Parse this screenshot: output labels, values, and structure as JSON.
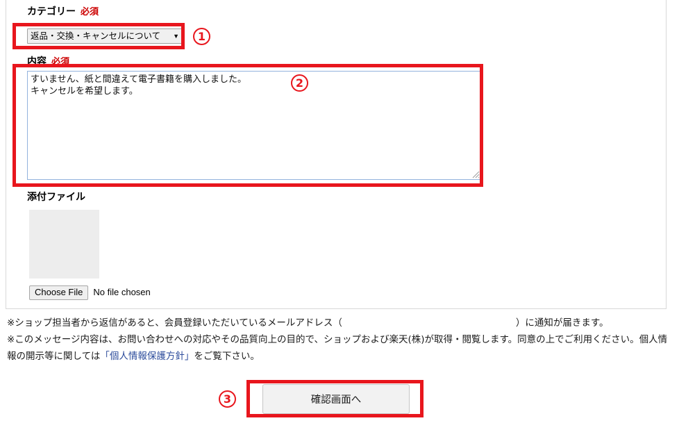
{
  "form": {
    "category": {
      "label": "カテゴリー",
      "required_badge": "必須",
      "selected_value": "返品・交換・キャンセルについて",
      "caret_icon": "▼"
    },
    "content": {
      "label": "内容",
      "required_badge": "必須",
      "value": "すいません、紙と間違えて電子書籍を購入しました。\nキャンセルを希望します。",
      "placeholder": ""
    },
    "attachment": {
      "label": "添付ファイル",
      "choose_file_label": "Choose File",
      "file_status": "No file chosen"
    }
  },
  "notices": {
    "line1_before_email": "※ショップ担当者から返信があると、会員登録いただいているメールアドレス（",
    "line1_after_email": "）に通知が届きます。",
    "line2_part1": "※このメッセージ内容は、お問い合わせへの対応やその品質向上の目的で、ショップおよび楽天(株)が取得・閲覧します。同意の上でご利用ください。個人情報の開示等に関しては",
    "policy_link": "「個人情報保護方針」",
    "line2_part2": "をご覧下さい。"
  },
  "submit": {
    "label": "確認画面へ"
  },
  "annotations": {
    "markers": [
      {
        "number": "①"
      },
      {
        "number": "②"
      },
      {
        "number": "③"
      }
    ],
    "color": "#e8161d"
  }
}
